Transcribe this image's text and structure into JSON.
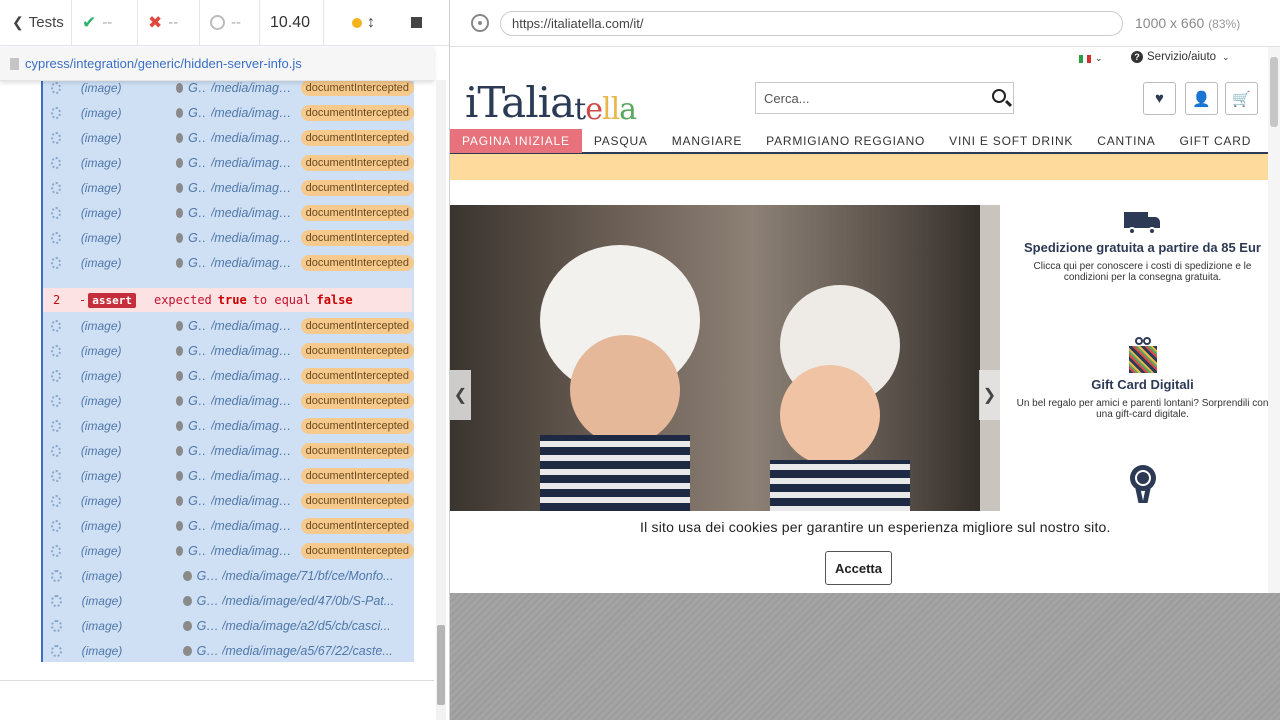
{
  "reporter": {
    "tests_label": "Tests",
    "passed": "--",
    "failed": "--",
    "pending": "--",
    "duration": "10.40",
    "spec_path": "cypress/integration/generic/hidden-server-info.js"
  },
  "commands_before": [
    {
      "type": "(image)",
      "method": "GET",
      "url": "/media/image/...",
      "status": "documentIntercepted"
    },
    {
      "type": "(image)",
      "method": "GET",
      "url": "/media/image/...",
      "status": "documentIntercepted"
    },
    {
      "type": "(image)",
      "method": "GET",
      "url": "/media/image/...",
      "status": "documentIntercepted"
    },
    {
      "type": "(image)",
      "method": "GET",
      "url": "/media/image/...",
      "status": "documentIntercepted"
    },
    {
      "type": "(image)",
      "method": "GET",
      "url": "/media/image/...",
      "status": "documentIntercepted"
    },
    {
      "type": "(image)",
      "method": "GET",
      "url": "/media/image/...",
      "status": "documentIntercepted"
    },
    {
      "type": "(image)",
      "method": "GET",
      "url": "/media/image/...",
      "status": "documentIntercepted"
    },
    {
      "type": "(image)",
      "method": "GET",
      "url": "/media/image/...",
      "status": "documentIntercepted"
    }
  ],
  "assert": {
    "number": "2",
    "dash": "-",
    "tag": "assert",
    "text_expected": "expected",
    "value_actual": "true",
    "text_to_equal": "to equal",
    "value_expected": "false"
  },
  "commands_after": [
    {
      "type": "(image)",
      "method": "GET",
      "url": "/media/image/...",
      "status": "documentIntercepted"
    },
    {
      "type": "(image)",
      "method": "GET",
      "url": "/media/image/...",
      "status": "documentIntercepted"
    },
    {
      "type": "(image)",
      "method": "GET",
      "url": "/media/image/...",
      "status": "documentIntercepted"
    },
    {
      "type": "(image)",
      "method": "GET",
      "url": "/media/image/...",
      "status": "documentIntercepted"
    },
    {
      "type": "(image)",
      "method": "GET",
      "url": "/media/image/...",
      "status": "documentIntercepted"
    },
    {
      "type": "(image)",
      "method": "GET",
      "url": "/media/image/...",
      "status": "documentIntercepted"
    },
    {
      "type": "(image)",
      "method": "GET",
      "url": "/media/image/...",
      "status": "documentIntercepted"
    },
    {
      "type": "(image)",
      "method": "GET",
      "url": "/media/image/...",
      "status": "documentIntercepted"
    },
    {
      "type": "(image)",
      "method": "GET",
      "url": "/media/image/...",
      "status": "documentIntercepted"
    },
    {
      "type": "(image)",
      "method": "GET",
      "url": "/media/image/...",
      "status": "documentIntercepted"
    },
    {
      "type": "(image)",
      "method": "GET",
      "url": "/media/image/71/bf/ce/Monfo...",
      "status": ""
    },
    {
      "type": "(image)",
      "method": "GET",
      "url": "/media/image/ed/47/0b/S-Pat...",
      "status": ""
    },
    {
      "type": "(image)",
      "method": "GET",
      "url": "/media/image/a2/d5/cb/casci...",
      "status": ""
    },
    {
      "type": "(image)",
      "method": "GET",
      "url": "/media/image/a5/67/22/caste...",
      "status": ""
    }
  ],
  "browser": {
    "url": "https://italiatella.com/it/",
    "viewport": "1000 x 660",
    "zoom": "(83%)"
  },
  "site": {
    "service_label": "Servizio/aiuto",
    "logo_main": "iTalia",
    "logo_t": "t",
    "logo_e": "e",
    "logo_ll": "ll",
    "logo_a": "a",
    "search_placeholder": "Cerca...",
    "nav": [
      "PAGINA INIZIALE",
      "PASQUA",
      "MANGIARE",
      "PARMIGIANO REGGIANO",
      "VINI E SOFT DRINK",
      "CANTINA",
      "GIFT CARD"
    ],
    "features": [
      {
        "title": "Spedizione gratuita a partire da 85 Eur",
        "text": "Clicca qui per conoscere i costi di spedizione e le condizioni per la consegna gratuita.",
        "icon": "truck-icon"
      },
      {
        "title": "Gift Card Digitali",
        "text": "Un bel regalo per amici e parenti lontani? Sorprendili con una gift-card digitale.",
        "icon": "gift-icon"
      },
      {
        "title": "",
        "text": "",
        "icon": "award-icon"
      }
    ],
    "cookie_text": "Il sito usa dei cookies per garantire un esperienza migliore sul nostro sito.",
    "cookie_button": "Accetta"
  },
  "colors": {
    "accent": "#e8727c",
    "promo": "#fedb9c",
    "brand_navy": "#2d3a55"
  }
}
